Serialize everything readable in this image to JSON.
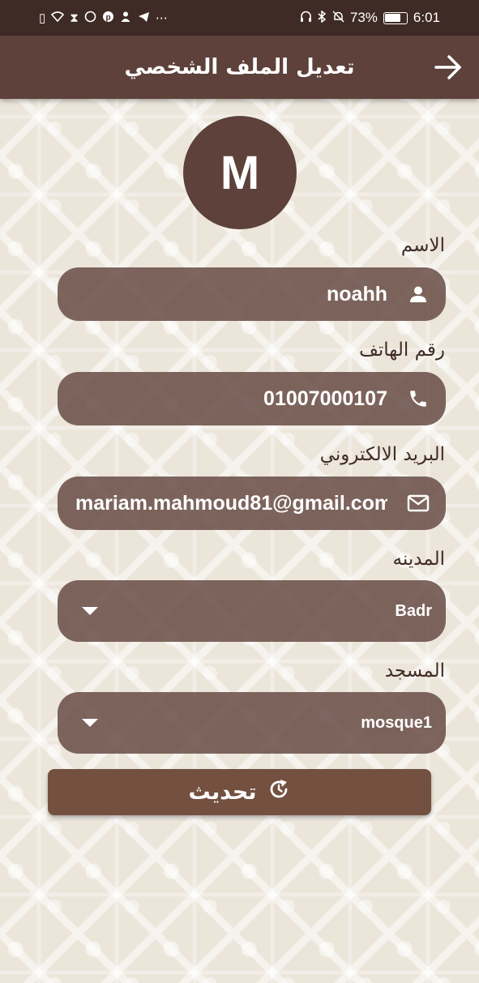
{
  "status_bar": {
    "battery": "73%",
    "time": "6:01",
    "left_icons": [
      "sim-alert-icon",
      "wifi-icon",
      "hourglass-icon",
      "whatsapp-icon",
      "pinterest-icon",
      "person-notify-icon",
      "telegram-icon",
      "more-dots-icon"
    ],
    "right_icons": [
      "headset-icon",
      "bluetooth-icon",
      "mute-bell-icon",
      "battery-icon"
    ]
  },
  "app_bar": {
    "title": "تعديل الملف الشخصي",
    "back_icon": "arrow-right-icon"
  },
  "avatar": {
    "initial": "M"
  },
  "form": {
    "name": {
      "label": "الاسم",
      "value": "noahh",
      "icon": "person-icon"
    },
    "phone": {
      "label": "رقم الهاتف",
      "value": "01007000107",
      "icon": "phone-icon"
    },
    "email": {
      "label": "البريد الالكتروني",
      "value": "mariam.mahmoud81@gmail.com",
      "icon": "mail-icon"
    },
    "city": {
      "label": "المدينه",
      "selected": "Badr"
    },
    "mosque": {
      "label": "المسجد",
      "selected": "mosque1"
    }
  },
  "update_button": {
    "label": "تحديث",
    "icon": "refresh-icon"
  },
  "colors": {
    "status_bar": "#3f2b25",
    "app_bar": "#5d413a",
    "field_bg": "#61463e",
    "button": "#73503f",
    "label_text": "#3f2b25"
  }
}
